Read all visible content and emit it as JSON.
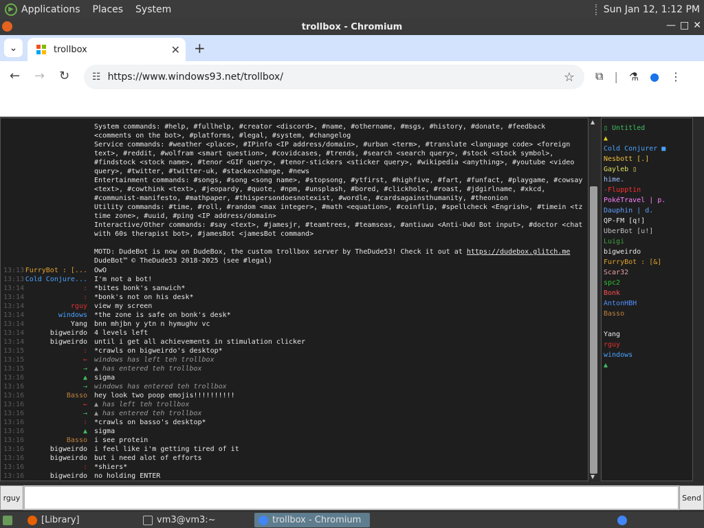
{
  "system_panel": {
    "menus": [
      "Applications",
      "Places",
      "System"
    ],
    "clock": "Sun Jan 12,  1:12 PM"
  },
  "window": {
    "title": "trollbox - Chromium"
  },
  "tab": {
    "title": "trollbox"
  },
  "address": {
    "url": "https://www.windows93.net/trollbox/"
  },
  "chat": {
    "system_text": [
      "System commands: #help, #fullhelp, #creator <discord>, #name, #othername, #msgs, #history, #donate, #feedback <comments on the bot>, #platforms, #legal, #system, #changelog",
      "Service commands: #weather <place>, #IPinfo <IP address/domain>, #urban <term>, #translate <language code> <foreign text>, #reddit, #wolfram <smart question>, #covidcases, #trends, #search <search query>, #stock <stock symbol>, #findstock <stock name>, #tenor <GIF query>, #tenor-stickers <sticker query>, #wikipedia <anything>, #youtube <video query>, #twitter, #twitter-uk, #stackexchange, #news",
      "Entertainment commands: #songs, #song <song name>, #stopsong, #ytfirst, #highfive, #fart, #funfact, #playgame, #cowsay <text>, #cowthink <text>, #jeopardy, #quote, #npm, #unsplash, #bored, #clickhole, #roast, #jdgirlname, #xkcd, #communist-manifesto, #mathpaper, #thispersondoesnotexist, #wordle, #cardsagainsthumanity, #theonion",
      "Utility commands: #time, #roll, #random <max integer>, #math <equation>, #coinflip, #spellcheck <Engrish>, #timein <tz time zone>, #uuid, #ping <IP address/domain>",
      "Interactive/Other commands: #say <text>, #jamesjr, #teamtrees, #teamseas, #antiuwu <Anti-UwU Bot input>, #doctor <chat with 60s therapist bot>, #jamesBot <jamesBot command>"
    ],
    "motd": "MOTD: DudeBot is now on DudeBox, the custom trollbox server by TheDude53! Check it out at ",
    "motd_link": "https://dudebox.glitch.me",
    "copyright": "DudeBot™ © TheDude53 2018-2025 (see #legal)",
    "messages": [
      {
        "time": "13:13",
        "nick": "FurryBot : [...",
        "nick_color": "#e0a030",
        "text": "OwO"
      },
      {
        "time": "13:13",
        "nick": "Cold Conjure...",
        "nick_color": "#4aa3ff",
        "text": "I'm not a bot!"
      },
      {
        "time": "13:14",
        "nick": ":",
        "nick_color": "#c03030",
        "text": "*bites bonk's sanwich*"
      },
      {
        "time": "13:14",
        "nick": ":",
        "nick_color": "#c03030",
        "text": "*bonk's not on his desk*"
      },
      {
        "time": "13:14",
        "nick": "rguy",
        "nick_color": "#e03030",
        "text": "view my screen"
      },
      {
        "time": "13:14",
        "nick": "windows",
        "nick_color": "#4aa3ff",
        "text": "*the zone is safe on bonk's desk*"
      },
      {
        "time": "13:14",
        "nick": "Yang",
        "nick_color": "#e8e8e8",
        "text": "bnn mhjbn y  ytn n hymughv  vc"
      },
      {
        "time": "13:14",
        "nick": "bigweirdo",
        "nick_color": "#e8e8e8",
        "text": "4 levels left"
      },
      {
        "time": "13:14",
        "nick": "bigweirdo",
        "nick_color": "#e8e8e8",
        "text": "until i get all achievements in stimulation clicker"
      },
      {
        "time": "13:15",
        "nick": ":",
        "nick_color": "#c03030",
        "text": "*crawls on bigweirdo's desktop*"
      },
      {
        "time": "13:15",
        "nick": "←",
        "nick_color": "#e03030",
        "text": "windows has left teh trollbox",
        "italic": true,
        "who": "windows",
        "who_color": "#4aa3ff"
      },
      {
        "time": "13:15",
        "nick": "→",
        "nick_color": "#40c060",
        "text": "▲ has entered teh trollbox",
        "italic": true
      },
      {
        "time": "13:16",
        "nick": "▲",
        "nick_color": "#40c060",
        "text": "sigma"
      },
      {
        "time": "13:16",
        "nick": "→",
        "nick_color": "#40c060",
        "text": "windows has entered teh trollbox",
        "italic": true,
        "who": "windows",
        "who_color": "#4aa3ff"
      },
      {
        "time": "13:16",
        "nick": "Basso",
        "nick_color": "#c08040",
        "text": "hey look two poop emojis!!!!!!!!!!"
      },
      {
        "time": "13:16",
        "nick": "←",
        "nick_color": "#e03030",
        "text": "▲ has left teh trollbox",
        "italic": true
      },
      {
        "time": "13:16",
        "nick": "→",
        "nick_color": "#40c060",
        "text": "▲ has entered teh trollbox",
        "italic": true
      },
      {
        "time": "13:16",
        "nick": ":",
        "nick_color": "#c03030",
        "text": "*crawls on basso's desktop*"
      },
      {
        "time": "13:16",
        "nick": "▲",
        "nick_color": "#40c060",
        "text": "sigma"
      },
      {
        "time": "13:16",
        "nick": "Basso",
        "nick_color": "#c08040",
        "text": "i see protein"
      },
      {
        "time": "13:16",
        "nick": "bigweirdo",
        "nick_color": "#e8e8e8",
        "text": "i feel like i'm getting tired of it"
      },
      {
        "time": "13:16",
        "nick": "bigweirdo",
        "nick_color": "#e8e8e8",
        "text": "but i need alot of efforts"
      },
      {
        "time": "13:16",
        "nick": ":",
        "nick_color": "#c03030",
        "text": "*shiers*"
      },
      {
        "time": "13:16",
        "nick": "bigweirdo",
        "nick_color": "#e8e8e8",
        "text": "no holding ENTER"
      }
    ]
  },
  "users": [
    {
      "name": "▯ Untitled",
      "color": "#40c060"
    },
    {
      "name": "▲",
      "color": "#e0d020"
    },
    {
      "name": "Cold Conjurer ■",
      "color": "#4aa3ff"
    },
    {
      "name": "Nesbott [.]",
      "color": "#f0c040"
    },
    {
      "name": "Gayleb ▯",
      "color": "#e0e060"
    },
    {
      "name": "hime.",
      "color": "#a0c0ff"
    },
    {
      "name": "-Flupptin",
      "color": "#ff3030"
    },
    {
      "name": "PokéTravel | p.",
      "color": "#ff80ff"
    },
    {
      "name": " Dauphin | d.",
      "color": "#60a0ff"
    },
    {
      "name": "QP-FM [q!]",
      "color": "#e8e8e8"
    },
    {
      "name": "UberBot [u!]",
      "color": "#c0c0c0"
    },
    {
      "name": "Luigi",
      "color": "#40a040"
    },
    {
      "name": "bigweirdo",
      "color": "#e8e8e8"
    },
    {
      "name": "FurryBot : [&]",
      "color": "#e0a030"
    },
    {
      "name": "Scar32",
      "color": "#e8a0a0"
    },
    {
      "name": "spc2",
      "color": "#30c030"
    },
    {
      "name": "Bonk",
      "color": "#ff5050"
    },
    {
      "name": "AntonHBH",
      "color": "#5090ff"
    },
    {
      "name": "Basso",
      "color": "#c08040"
    },
    {
      "name": "",
      "color": "#e8e8e8"
    },
    {
      "name": "Yang",
      "color": "#e8e8e8"
    },
    {
      "name": "rguy",
      "color": "#e03030"
    },
    {
      "name": "windows",
      "color": "#4aa3ff"
    },
    {
      "name": "▲",
      "color": "#40c060"
    }
  ],
  "input": {
    "nick_label": "rguy",
    "send_label": "Send",
    "value": ""
  },
  "taskbar": {
    "items": [
      "[Library]",
      "vm3@vm3:~",
      "trollbox - Chromium"
    ]
  }
}
